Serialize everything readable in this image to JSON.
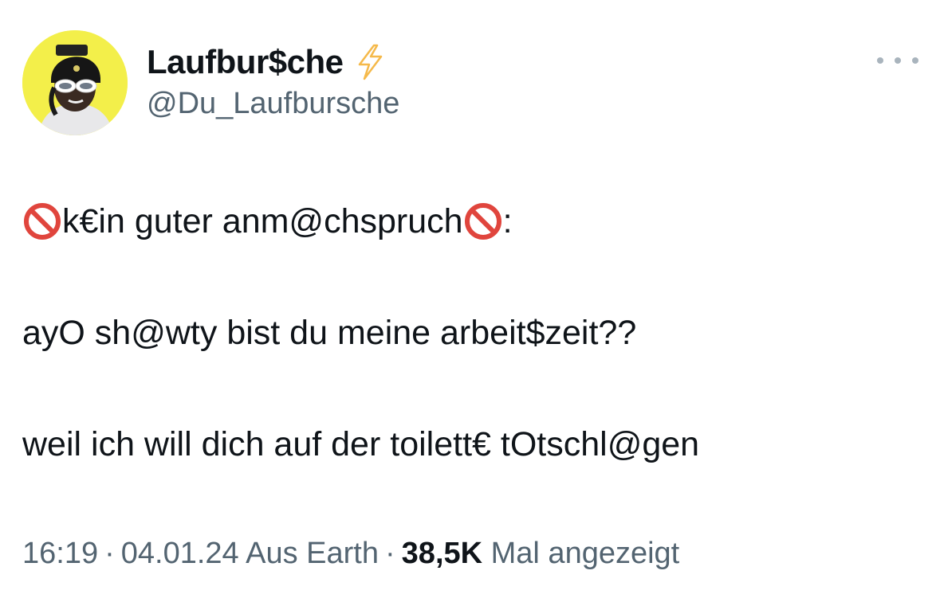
{
  "author": {
    "display_name": "Laufbur$che",
    "handle": "@Du_Laufbursche",
    "badge_icon": "lightning-bolt-icon",
    "avatar_bg": "#f3ef4a"
  },
  "tweet": {
    "line1_text": "k€in guter anm@chspruch",
    "line1_suffix": ":",
    "line1_icon": "no-entry-icon",
    "line2_text": "ayO sh@wty bist du meine arbeit$zeit??",
    "line3_text": "weil ich will dich auf der toilett€ tOtschl@gen"
  },
  "meta": {
    "time": "16:19",
    "separator": "·",
    "date": "04.01.24",
    "source": "Aus Earth",
    "views_count": "38,5K",
    "views_label": "Mal angezeigt"
  },
  "colors": {
    "text": "#0f1419",
    "secondary": "#536471",
    "bolt": "#f5b94a",
    "no_entry": "#e0453d"
  }
}
